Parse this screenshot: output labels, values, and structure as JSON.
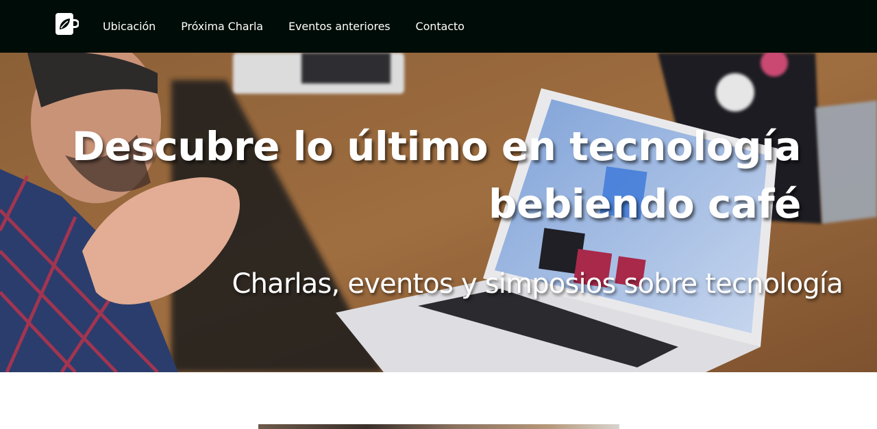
{
  "navbar": {
    "logo_icon": "coffee-mug-leaf-icon",
    "links": [
      {
        "label": "Ubicación"
      },
      {
        "label": "Próxima Charla"
      },
      {
        "label": "Eventos anteriores"
      },
      {
        "label": "Contacto"
      }
    ],
    "background_color": "#000c07"
  },
  "hero": {
    "title_line1": "Descubre lo último en tecnología",
    "title_line2": "bebiendo café",
    "subtitle": "Charlas, eventos y simposios sobre tecnología",
    "image_description_icon": "laptop-meeting-photo"
  }
}
